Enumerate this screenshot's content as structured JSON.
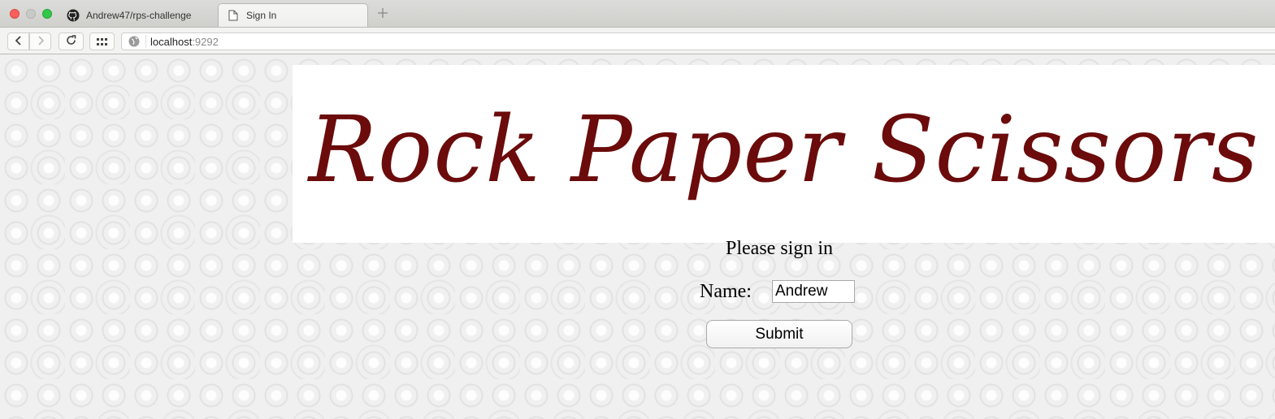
{
  "browser": {
    "tabs": [
      {
        "label": "Andrew47/rps-challenge",
        "icon": "github-icon",
        "active": false
      },
      {
        "label": "Sign In",
        "icon": "page-icon",
        "active": true
      }
    ],
    "address": {
      "host": "localhost",
      "port": ":9292"
    }
  },
  "page": {
    "banner_title": "Rock Paper Scissors",
    "prompt": "Please sign in",
    "name_label": "Name:",
    "name_value": "Andrew",
    "submit_label": "Submit"
  },
  "colors": {
    "title": "#6b0b0b",
    "banner_bg": "#ffffff",
    "page_bg": "#f0f0f0"
  }
}
